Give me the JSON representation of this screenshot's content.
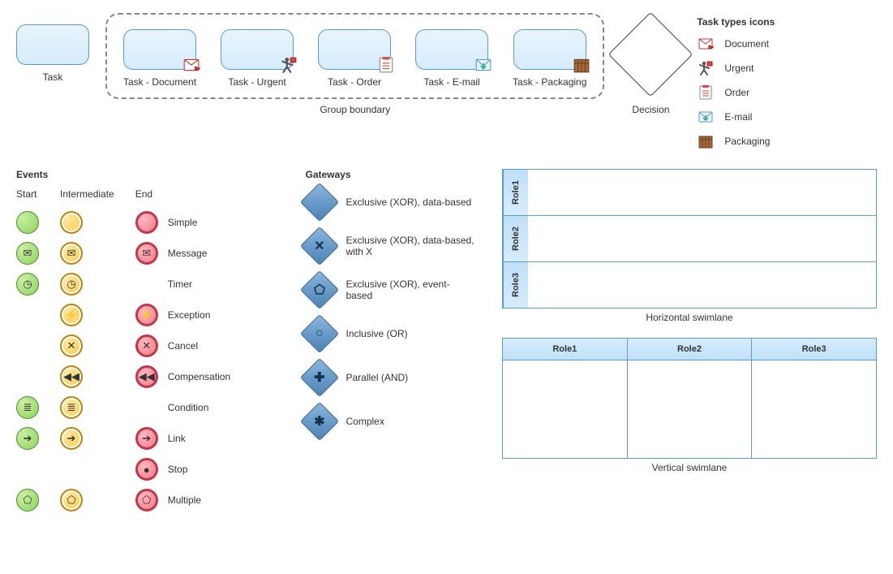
{
  "task_single_label": "Task",
  "group_boundary_label": "Group boundary",
  "group_tasks": [
    {
      "label": "Task - Document",
      "icon": "document-icon"
    },
    {
      "label": "Task - Urgent",
      "icon": "urgent-icon"
    },
    {
      "label": "Task - Order",
      "icon": "order-icon"
    },
    {
      "label": "Task - E-mail",
      "icon": "email-icon"
    },
    {
      "label": "Task - Packaging",
      "icon": "packaging-icon"
    }
  ],
  "decision_label": "Decision",
  "task_types": {
    "title": "Task types icons",
    "items": [
      {
        "icon": "document-icon",
        "label": "Document"
      },
      {
        "icon": "urgent-icon",
        "label": "Urgent"
      },
      {
        "icon": "order-icon",
        "label": "Order"
      },
      {
        "icon": "email-icon",
        "label": "E-mail"
      },
      {
        "icon": "packaging-icon",
        "label": "Packaging"
      }
    ]
  },
  "events": {
    "title": "Events",
    "start_label": "Start",
    "intermediate_label": "Intermediate",
    "end_label": "End",
    "rows": [
      {
        "name": "Simple",
        "start": true,
        "inter": true,
        "end": true,
        "glyph": ""
      },
      {
        "name": "Message",
        "start": true,
        "inter": true,
        "end": true,
        "glyph": "✉"
      },
      {
        "name": "Timer",
        "start": true,
        "inter": true,
        "end": false,
        "glyph": "◷"
      },
      {
        "name": "Exception",
        "start": false,
        "inter": true,
        "end": true,
        "glyph": "⚡"
      },
      {
        "name": "Cancel",
        "start": false,
        "inter": true,
        "end": true,
        "glyph": "✕"
      },
      {
        "name": "Compensation",
        "start": false,
        "inter": true,
        "end": true,
        "glyph": "◀◀"
      },
      {
        "name": "Condition",
        "start": true,
        "inter": true,
        "end": false,
        "glyph": "≣"
      },
      {
        "name": "Link",
        "start": true,
        "inter": true,
        "end": true,
        "glyph": "➔"
      },
      {
        "name": "Stop",
        "start": false,
        "inter": false,
        "end": true,
        "glyph": "●"
      },
      {
        "name": "Multiple",
        "start": true,
        "inter": true,
        "end": true,
        "glyph": "⬠"
      }
    ]
  },
  "gateways": {
    "title": "Gateways",
    "items": [
      {
        "label": "Exclusive (XOR), data-based",
        "glyph": ""
      },
      {
        "label": "Exclusive (XOR), data-based, with X",
        "glyph": "✕"
      },
      {
        "label": "Exclusive (XOR), event-based",
        "glyph": "⬠"
      },
      {
        "label": "Inclusive (OR)",
        "glyph": "○"
      },
      {
        "label": "Parallel (AND)",
        "glyph": "✚"
      },
      {
        "label": "Complex",
        "glyph": "✱"
      }
    ]
  },
  "swimlanes": {
    "horizontal_caption": "Horizontal swimlane",
    "vertical_caption": "Vertical swimlane",
    "roles": [
      "Role1",
      "Role2",
      "Role3"
    ]
  },
  "colors": {
    "task_fill": "#d6ecfc",
    "task_border": "#5a9bd5",
    "start": "#8ed25e",
    "intermediate": "#f8c948",
    "end": "#f37a88",
    "gateway": "#4a82b6"
  }
}
